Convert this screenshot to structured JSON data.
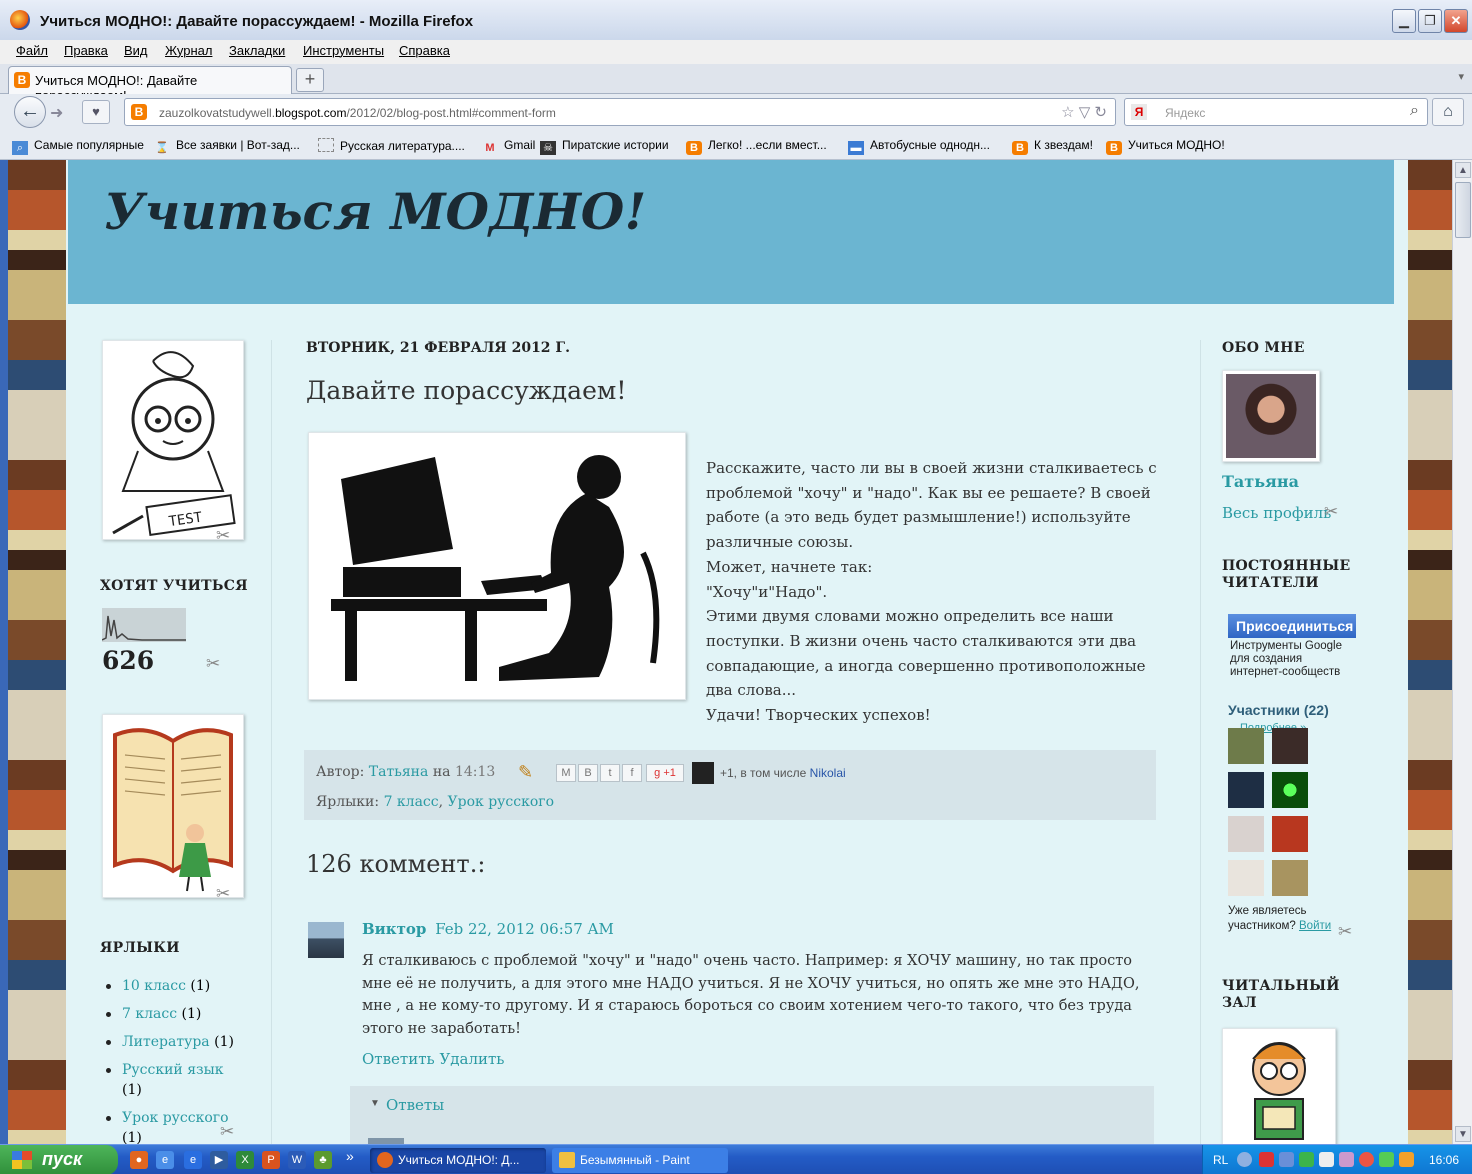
{
  "window": {
    "title": "Учиться МОДНО!: Давайте порассуждаем! - Mozilla Firefox"
  },
  "menu": [
    "Файл",
    "Правка",
    "Вид",
    "Журнал",
    "Закладки",
    "Инструменты",
    "Справка"
  ],
  "tab": {
    "label": "Учиться МОДНО!: Давайте порассуждаем!",
    "new_tab": "+"
  },
  "address": {
    "host_prefix": "zauzolkovatstudywell.",
    "host_main": "blogspot.com",
    "path": "/2012/02/blog-post.html#comment-form"
  },
  "search": {
    "placeholder": "Яндекс"
  },
  "bookmarks": [
    "Самые популярные",
    "Все заявки | Вот-зад...",
    "Русская литература....",
    "Gmail",
    "Пиратские истории",
    "Легко! ...если вмест...",
    "Автобусные однодн...",
    "К звездам!",
    "Учиться МОДНО!"
  ],
  "blog": {
    "title": "Учиться МОДНО!",
    "date": "ВТОРНИК, 21 ФЕВРАЛЯ 2012 Г.",
    "post_title": "Давайте порассуждаем!",
    "post_paragraphs": [
      "Расскажите, часто ли вы в своей жизни сталкиваетесь с проблемой \"хочу\" и \"надо\". Как вы ее решаете? В своей работе (а это ведь будет размышление!) используйте различные союзы.",
      "Может, начнете так:",
      "\"Хочу\"и\"Надо\".",
      "Этими двумя словами можно определить все наши поступки. В жизни очень часто сталкиваются эти два совпадающие, а иногда совершенно противоположные два слова...",
      "Удачи! Творческих успехов!"
    ],
    "author_prefix": "Автор:",
    "author": "Татьяна",
    "time_prefix": "на",
    "time": "14:13",
    "plusone": "+1",
    "plus_text": "+1, в том числе",
    "plus_user": "Nikolai",
    "labels_prefix": "Ярлыки:",
    "labels": [
      "7 класс",
      "Урок русского"
    ],
    "comments_title": "126 коммент.:",
    "comment": {
      "author": "Виктор",
      "date": "Feb 22, 2012 06:57 AM",
      "text": "Я сталкиваюсь с проблемой \"хочу\" и \"надо\" очень часто. Например: я ХОЧУ машину, но так просто мне её не получить, а для этого мне НАДО учиться. Я не ХОЧУ учиться, но опять же мне это НАДО, мне , а не кому-то другому. И я стараюсь бороться со своим хотением чего-то такого, что без труда этого не заработать!",
      "reply": "Ответить",
      "delete": "Удалить"
    },
    "replies_label": "Ответы"
  },
  "left_sidebar": {
    "want_title": "ХОТЯТ УЧИТЬСЯ",
    "counter": "626",
    "labels_title": "ЯРЛЫКИ",
    "labels": [
      {
        "name": "10 класс",
        "count": "(1)"
      },
      {
        "name": "7 класс",
        "count": "(1)"
      },
      {
        "name": "Литература",
        "count": "(1)"
      },
      {
        "name": "Русский язык",
        "count": "(1)"
      },
      {
        "name": "Урок русского",
        "count": "(1)"
      }
    ]
  },
  "right_sidebar": {
    "about_title": "ОБО МНЕ",
    "name": "Татьяна",
    "profile_link": "Весь профиль",
    "followers_title": "ПОСТОЯННЫЕ ЧИТАТЕЛИ",
    "join_button": "Присоединиться",
    "join_desc": "Инструменты Google для создания интернет-сообществ",
    "members": "Участники (22)",
    "more": "Подробнее »",
    "already_member": "Уже являетесь участником?",
    "login": "Войти",
    "reading_title": "ЧИТАЛЬНЫЙ ЗАЛ"
  },
  "taskbar": {
    "start": "пуск",
    "more": "»",
    "tasks": [
      "Учиться МОДНО!: Д...",
      "Безымянный - Paint"
    ],
    "lang": "RL",
    "clock": "16:06"
  }
}
